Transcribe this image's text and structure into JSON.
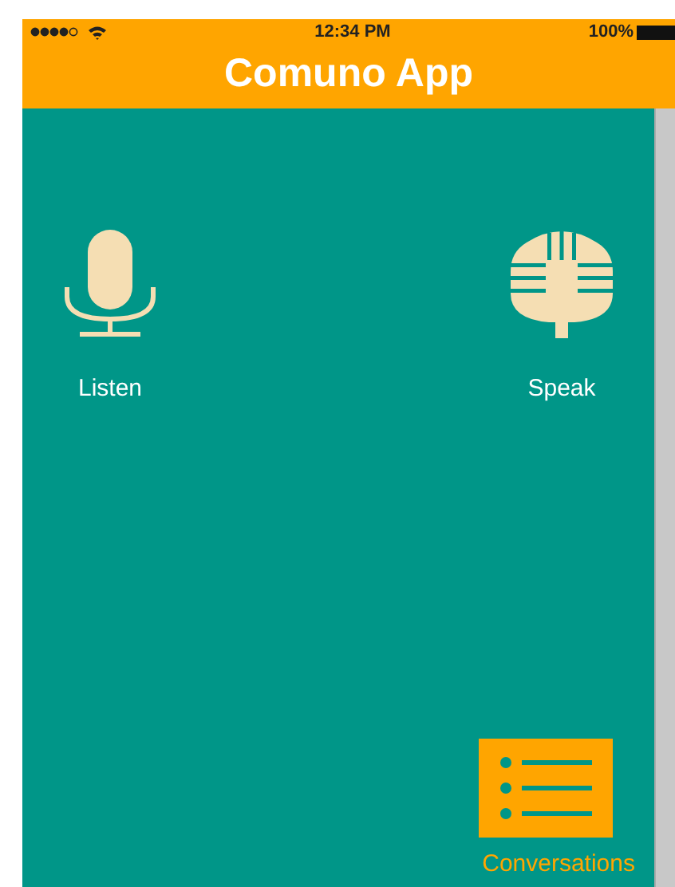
{
  "status_bar": {
    "time": "12:34 PM",
    "battery": "100%"
  },
  "title": "Comuno App",
  "actions": [
    {
      "kind": "listen",
      "label": "Listen"
    },
    {
      "kind": "speak",
      "label": "Speak"
    }
  ],
  "conversations": {
    "label": "Conversations"
  }
}
